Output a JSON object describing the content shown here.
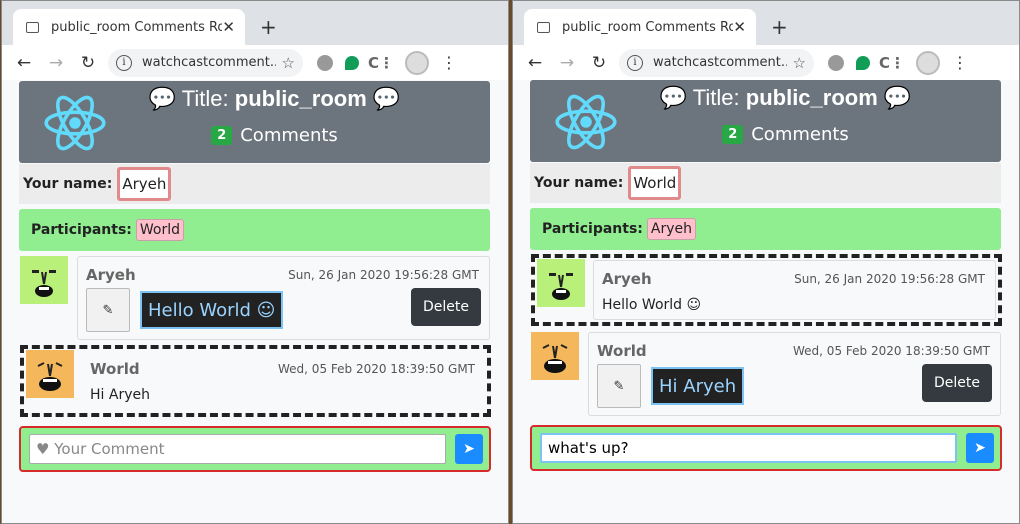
{
  "left": {
    "tab_title": "public_room Comments Room",
    "url": "watchcastcomment...",
    "header": {
      "title_prefix": "💬 Title: ",
      "title_name": "public_room",
      "title_suffix": " 💬",
      "count": "2",
      "comments_label": "Comments"
    },
    "your_name_label": "Your name:",
    "your_name_value": "Aryeh",
    "participants_label": "Participants:",
    "participants": [
      "World"
    ],
    "comments": [
      {
        "author": "Aryeh",
        "timestamp": "Sun, 26 Jan 2020 19:56:28 GMT",
        "edit_text": "Hello World ☺",
        "edit_icon": "✎",
        "delete_label": "Delete"
      },
      {
        "author": "World",
        "timestamp": "Wed, 05 Feb 2020 18:39:50 GMT",
        "text": "Hi Aryeh"
      }
    ],
    "composer_placeholder": "♥ Your Comment",
    "send_icon": "➤"
  },
  "right": {
    "tab_title": "public_room Comments Room",
    "url": "watchcastcomment...",
    "header": {
      "title_prefix": "💬 Title: ",
      "title_name": "public_room",
      "title_suffix": " 💬",
      "count": "2",
      "comments_label": "Comments"
    },
    "your_name_label": "Your name:",
    "your_name_value": "World",
    "participants_label": "Participants:",
    "participants": [
      "Aryeh"
    ],
    "comments": [
      {
        "author": "Aryeh",
        "timestamp": "Sun, 26 Jan 2020 19:56:28 GMT",
        "text": "Hello World ☺"
      },
      {
        "author": "World",
        "timestamp": "Wed, 05 Feb 2020 18:39:50 GMT",
        "edit_text": "Hi Aryeh",
        "edit_icon": "✎",
        "delete_label": "Delete"
      }
    ],
    "composer_value": "what's up?",
    "send_icon": "➤"
  },
  "colors": {
    "header_bg": "#6c757d",
    "participants_bg": "#90ee90",
    "participant_tag": "#ffc0cb",
    "badge": "#28a745",
    "send_button": "#1a8cff",
    "react_logo": "#61dafb"
  }
}
